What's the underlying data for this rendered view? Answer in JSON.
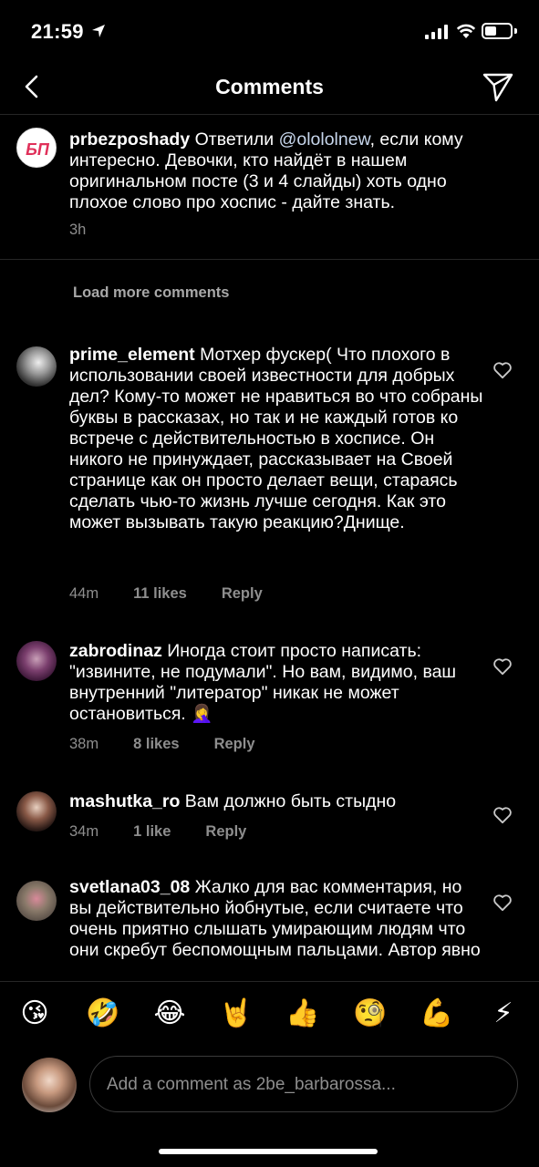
{
  "status_bar": {
    "time": "21:59"
  },
  "header": {
    "title": "Comments"
  },
  "caption": {
    "username": "prbezposhady",
    "avatar_text": "БП",
    "text_before": " Ответили ",
    "mention": "@olololnew",
    "text_after": ", если кому интересно. Девочки, кто найдёт в нашем оригинальном посте (3 и 4 слайды) хоть одно плохое слово про хоспис - дайте знать.",
    "time": "3h"
  },
  "load_more": "Load more comments",
  "comments": [
    {
      "username": "prime_element",
      "text": " Мотхер фускер( Что плохого в использовании своей известности для добрых дел? Кому-то может не нравиться во что собраны буквы в рассказах, но так и не каждый готов ко встрече с действительностью в хосписе. Он никого не принуждает, рассказывает на Своей странице как он просто делает вещи, стараясь сделать чью-то жизнь лучше сегодня. Как это может вызывать такую реакцию?Днище.",
      "time": "44m",
      "likes": "11 likes",
      "reply": "Reply"
    },
    {
      "username": "zabrodinaz",
      "text": " Иногда стоит просто написать: \"извините, не подумали\". Но вам, видимо, ваш внутренний \"литератор\" никак не может остановиться. 🤦‍♀️",
      "time": "38m",
      "likes": "8 likes",
      "reply": "Reply"
    },
    {
      "username": "mashutka_ro",
      "text": " Вам должно быть стыдно",
      "time": "34m",
      "likes": "1 like",
      "reply": "Reply"
    },
    {
      "username": "svetlana03_08",
      "text": " Жалко для вас комментария, но вы действительно йобнутые, если считаете что очень приятно слышать умирающим людям что они скребут беспомощным пальцами. Автор явно",
      "time": "",
      "likes": "",
      "reply": ""
    }
  ],
  "emoji_bar": [
    "😘",
    "🤣",
    "😂",
    "🤘",
    "👍",
    "🧐",
    "💪",
    "⚡"
  ],
  "composer": {
    "placeholder": "Add a comment as 2be_barbarossa..."
  },
  "colors": {
    "background": "#000000",
    "secondary_text": "#8e8e8e",
    "divider": "#262626",
    "mention": "#c7d6ec"
  }
}
